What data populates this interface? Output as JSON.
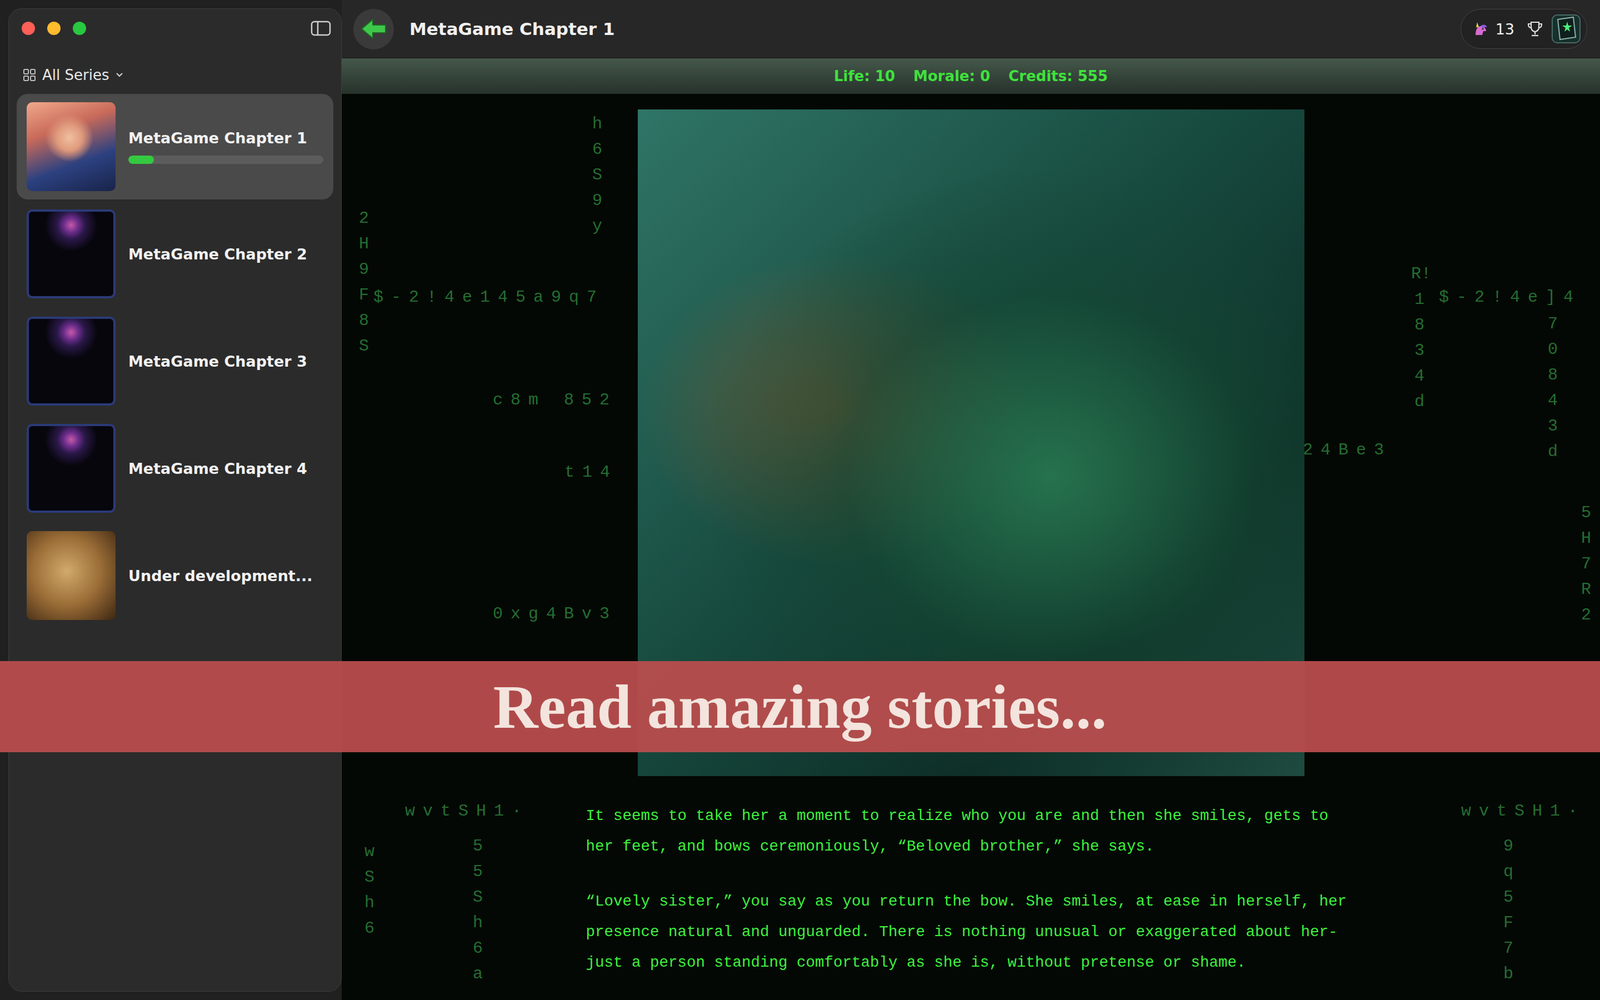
{
  "toolbar": {
    "title": "MetaGame Chapter 1",
    "badge": "13"
  },
  "sidebar": {
    "filter": "All Series",
    "items": [
      {
        "title": "MetaGame Chapter 1",
        "selected": true,
        "kind": "started",
        "level": 0.13
      },
      {
        "title": "MetaGame Chapter 2",
        "selected": false,
        "kind": "chapter"
      },
      {
        "title": "MetaGame Chapter 3",
        "selected": false,
        "kind": "chapter"
      },
      {
        "title": "MetaGame Chapter 4",
        "selected": false,
        "kind": "chapter"
      },
      {
        "title": "Under development...",
        "selected": false,
        "kind": "draft"
      }
    ]
  },
  "stats": [
    "Life: 10",
    "Morale: 0",
    "Credits: 555"
  ],
  "banner": {
    "text": "Read amazing stories..."
  },
  "story": [
    "It seems to take her a moment to realize who you are and then she smiles, gets to her feet, and bows ceremoniously, “Beloved brother,” she says.",
    "“Lovely sister,” you say as you return the bow. She smiles, at ease in herself, her presence natural and unguarded. There is nothing unusual or exaggerated about her-just a person standing comfortably as she is, without pretense or shame."
  ],
  "matrix_rain": [
    {
      "text": "$-2!4e145a9q7",
      "kind": "row"
    },
    {
      "text": "$-2!4e]4",
      "kind": "row"
    },
    {
      "text": "c8m 852",
      "kind": "row"
    },
    {
      "text": "t14",
      "kind": "row"
    },
    {
      "text": "0xg4Bv3",
      "kind": "row"
    },
    {
      "text": "24Be3",
      "kind": "row"
    },
    {
      "text": "wvtSH1·",
      "kind": "row"
    },
    {
      "text": "wvtSH1·",
      "kind": "row"
    },
    {
      "text": "2H9F8S",
      "kind": "column"
    },
    {
      "text": "70843d",
      "kind": "column"
    },
    {
      "text": "R!1834d",
      "kind": "column"
    },
    {
      "text": "h6S9y",
      "kind": "column"
    },
    {
      "text": "55Sh6a",
      "kind": "column"
    },
    {
      "text": "9q5F7b",
      "kind": "column"
    },
    {
      "text": "wSh6",
      "kind": "column"
    },
    {
      "text": "5H7R2",
      "kind": "column"
    }
  ]
}
